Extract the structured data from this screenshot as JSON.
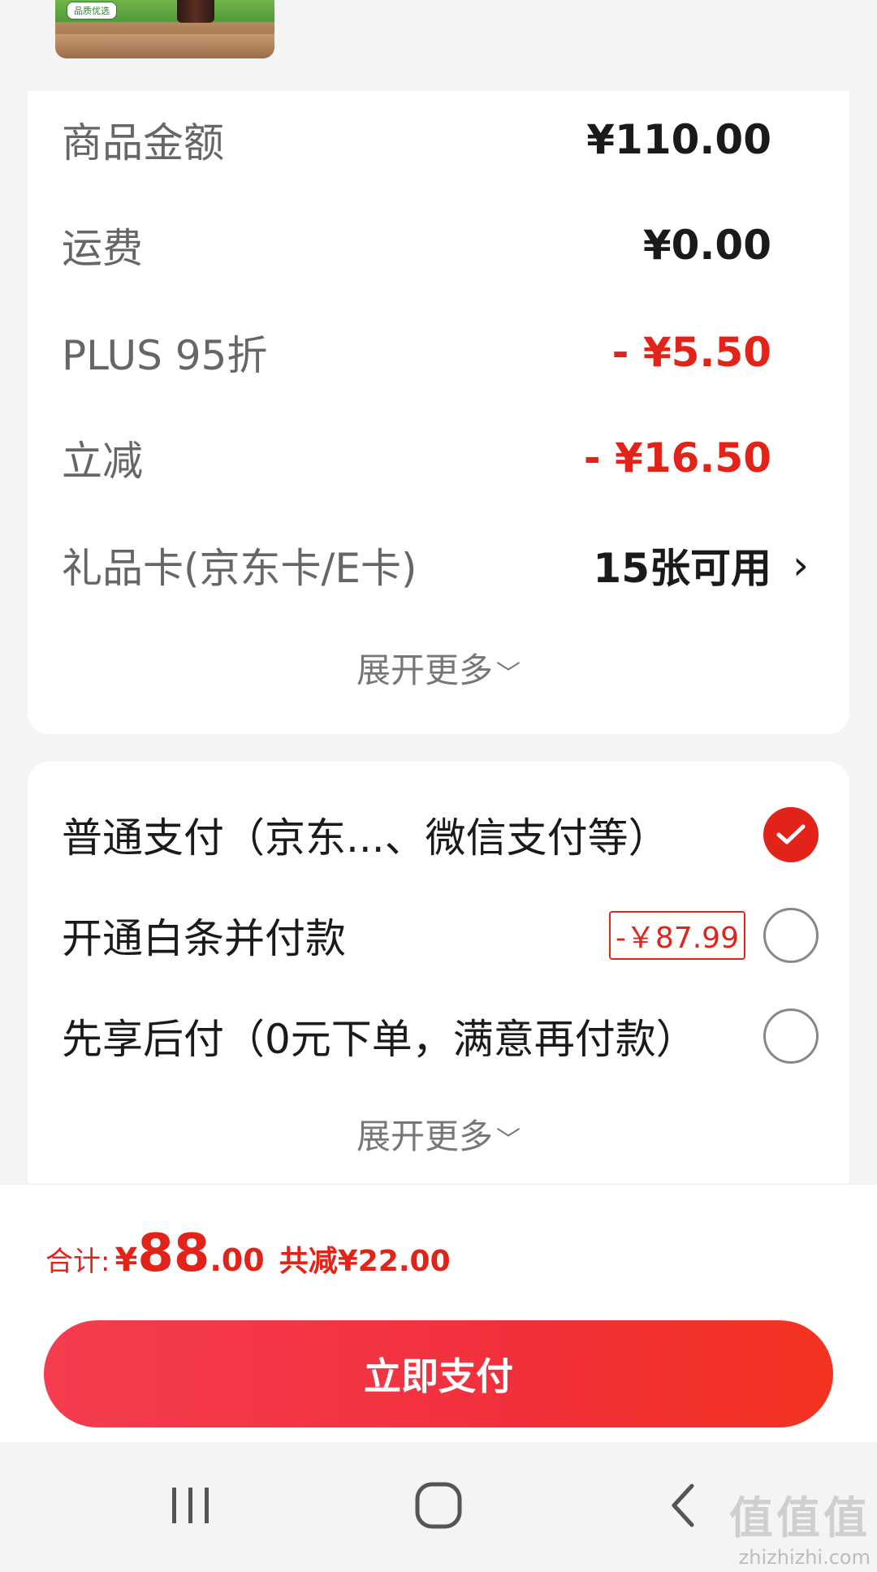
{
  "product": {
    "badge": "品质优选"
  },
  "price_summary": {
    "rows": [
      {
        "label": "商品金额",
        "value": "¥110.00"
      },
      {
        "label": "运费",
        "value": "¥0.00"
      },
      {
        "label": "PLUS 95折",
        "value": "- ¥5.50"
      },
      {
        "label": "立减",
        "value": "- ¥16.50"
      },
      {
        "label": "礼品卡(京东卡/E卡)",
        "value": "15张可用"
      }
    ],
    "expand_label": "展开更多"
  },
  "payment": {
    "options": [
      {
        "label": "普通支付（京东...、微信支付等）",
        "selected": true
      },
      {
        "label": "开通白条并付款",
        "tag": "-￥87.99",
        "selected": false
      },
      {
        "label": "先享后付（0元下单，满意再付款）",
        "selected": false
      }
    ],
    "expand_label": "展开更多"
  },
  "total": {
    "prefix": "合计:",
    "currency": "¥",
    "integer": "88",
    "decimal": ".00",
    "saved": "共减¥22.00"
  },
  "pay_button": {
    "label": "立即支付"
  },
  "watermark": {
    "glyphs": "值值值",
    "site": "zhizhizhi.com"
  },
  "colors": {
    "accent": "#e2231a",
    "button_start": "#f53d4f",
    "button_end": "#f2331f"
  }
}
